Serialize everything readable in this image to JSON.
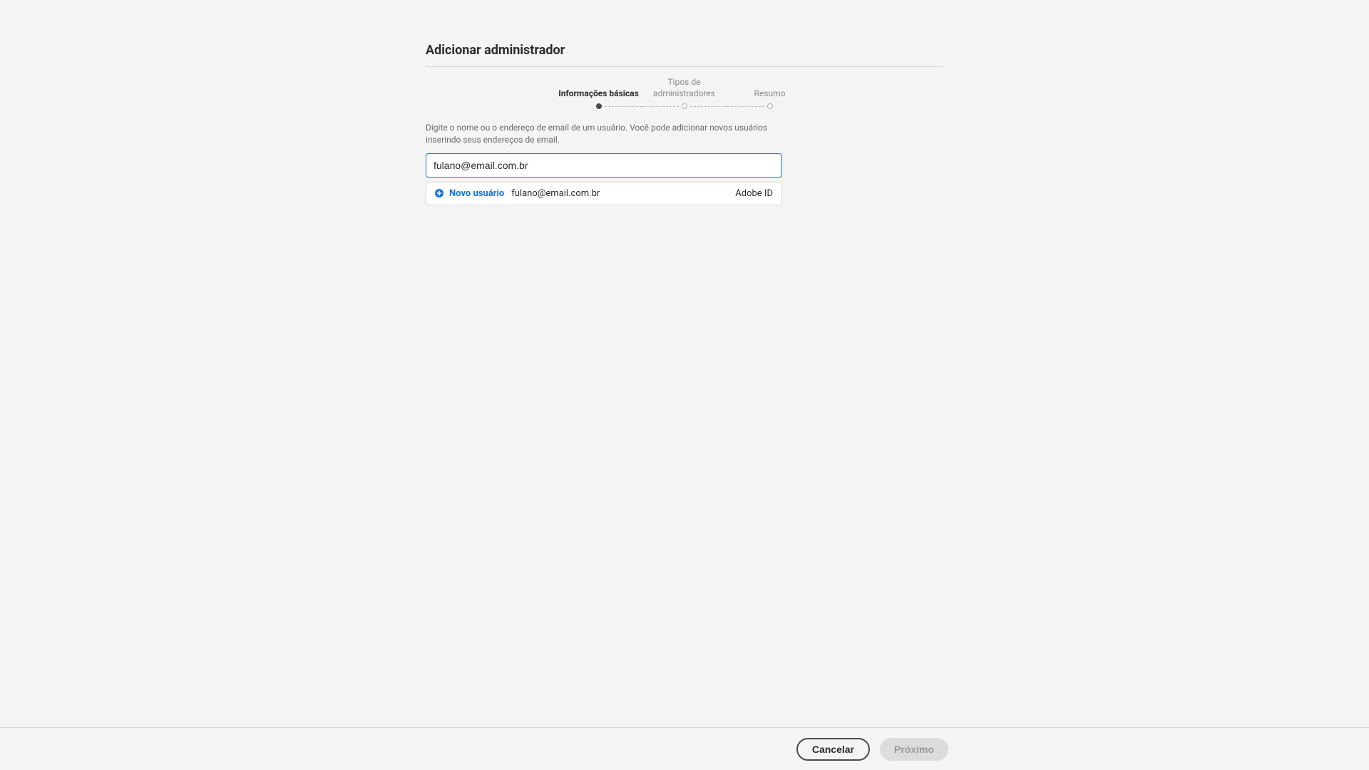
{
  "modal": {
    "title": "Adicionar administrador"
  },
  "stepper": {
    "steps": [
      {
        "label": "Informações básicas"
      },
      {
        "label": "Tipos de administradores"
      },
      {
        "label": "Resumo"
      }
    ]
  },
  "instructions": "Digite o nome ou o endereço de email de um usuário. Você pode adicionar novos usuários inserindo seus endereços de email.",
  "input": {
    "value": "fulano@email.com.br"
  },
  "suggestion": {
    "new_user_label": "Novo usuário",
    "email": "fulano@email.com.br",
    "id_type": "Adobe ID"
  },
  "footer": {
    "cancel": "Cancelar",
    "next": "Próximo"
  },
  "icons": {
    "plus": "plus-circle-icon"
  }
}
